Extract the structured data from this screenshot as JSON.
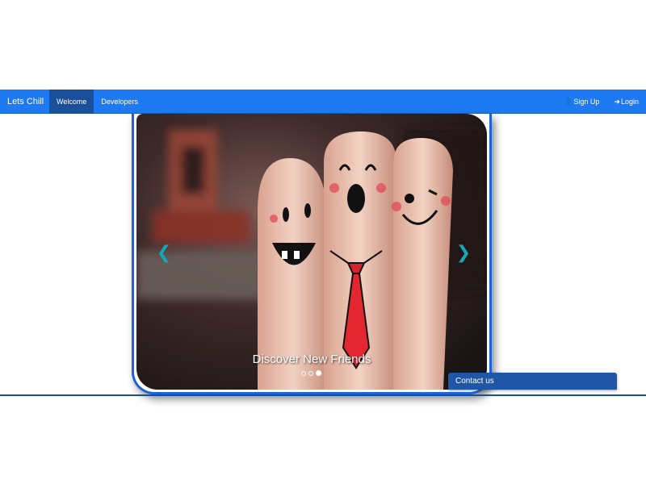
{
  "navbar": {
    "brand": "Lets Chill",
    "left_items": [
      {
        "label": "Welcome",
        "active": true
      },
      {
        "label": "Developers",
        "active": false
      }
    ],
    "right_items": [
      {
        "label": "Sign Up",
        "icon": "user-icon"
      },
      {
        "label": "Login",
        "icon": "login-icon"
      }
    ]
  },
  "carousel": {
    "caption": "Discover New Friends",
    "slide_count": 3,
    "active_index": 2
  },
  "contact": {
    "label": "Contact us"
  },
  "colors": {
    "navbar": "#1d7af3",
    "active_nav": "#1a4f9c",
    "carousel_border": "#1c63d6",
    "contact_bar": "#1f56a6",
    "arrows": "#13a9b8"
  }
}
